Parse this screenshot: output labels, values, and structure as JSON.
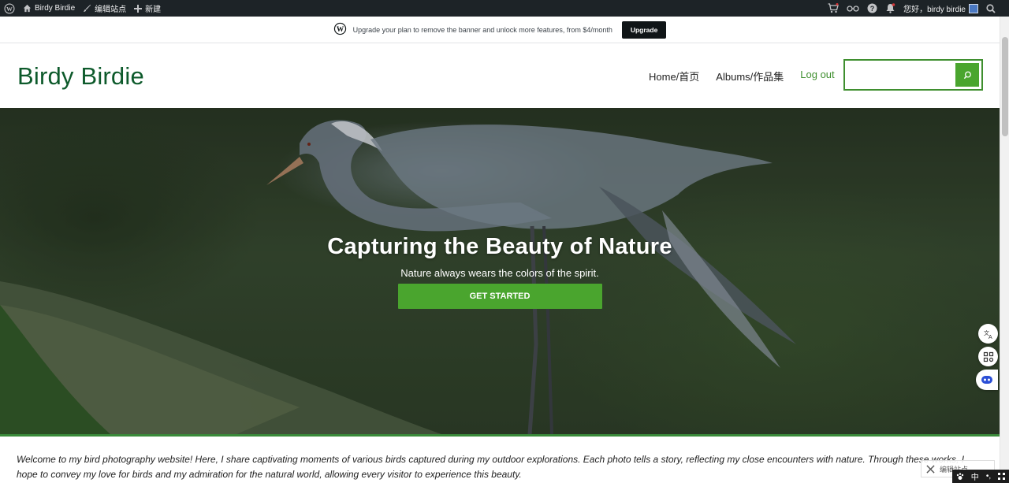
{
  "admin_bar": {
    "site_name": "Birdy Birdie",
    "edit_site": "编辑站点",
    "new": "新建",
    "greeting": "您好，birdy birdie"
  },
  "banner": {
    "text": "Upgrade your plan to remove the banner and unlock more features, from $4/month",
    "button": "Upgrade"
  },
  "header": {
    "site_title": "Birdy Birdie",
    "nav": [
      "Home/首页",
      "Albums/作品集",
      "Log out"
    ],
    "search_placeholder": ""
  },
  "hero": {
    "title": "Capturing the Beauty of Nature",
    "subtitle": "Nature always wears the colors of the spirit.",
    "cta": "GET STARTED"
  },
  "intro": {
    "text": "Welcome to my bird photography website! Here, I share captivating moments of various birds captured during my outdoor explorations. Each photo tells a story, reflecting my close encounters with nature. Through these works, I hope to convey my love for birds and my admiration for the natural world, allowing every visitor to experience this beauty."
  },
  "floating": {
    "edit_label": "编辑站点",
    "ime": [
      "中",
      "•,"
    ]
  },
  "colors": {
    "admin_bg": "#1d2327",
    "brand_green": "#0d5a2b",
    "accent_green": "#4aa52e"
  }
}
